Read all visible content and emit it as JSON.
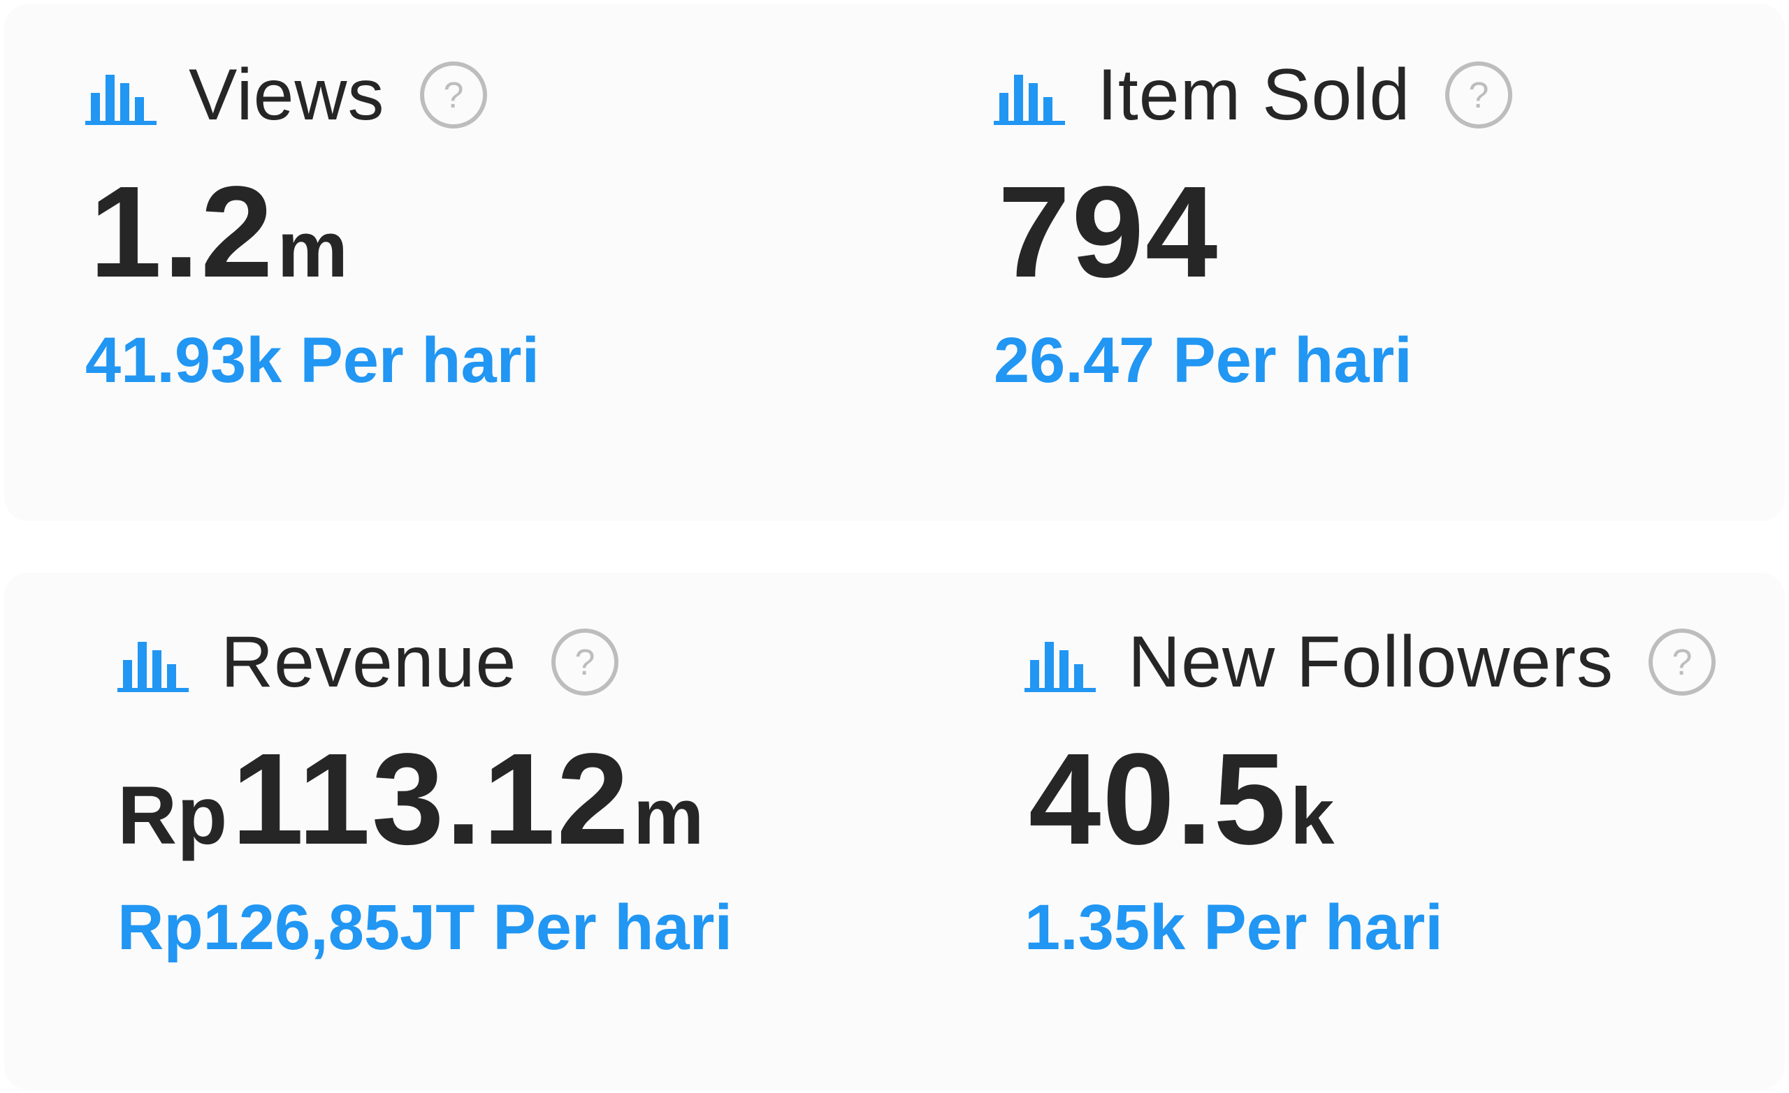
{
  "colors": {
    "accent": "#2196f3",
    "text": "#262626",
    "help_icon": "#bdbdbd",
    "panel_bg": "#fbfbfb"
  },
  "icons": {
    "metric": "bar-chart-icon",
    "help": "question-circle-icon"
  },
  "metrics": [
    {
      "label": "Views",
      "value_prefix": "",
      "value": "1.2",
      "value_suffix": "m",
      "per_day_value": "41.93k",
      "per_day_text": "Per hari"
    },
    {
      "label": "Item Sold",
      "value_prefix": "",
      "value": "794",
      "value_suffix": "",
      "per_day_value": "26.47",
      "per_day_text": "Per hari"
    },
    {
      "label": "Revenue",
      "value_prefix": "Rp",
      "value": "113.12",
      "value_suffix": "m",
      "per_day_value": "Rp126,85JT",
      "per_day_text": "Per hari"
    },
    {
      "label": "New Followers",
      "value_prefix": "",
      "value": "40.5",
      "value_suffix": "k",
      "per_day_value": "1.35k",
      "per_day_text": "Per hari"
    }
  ]
}
